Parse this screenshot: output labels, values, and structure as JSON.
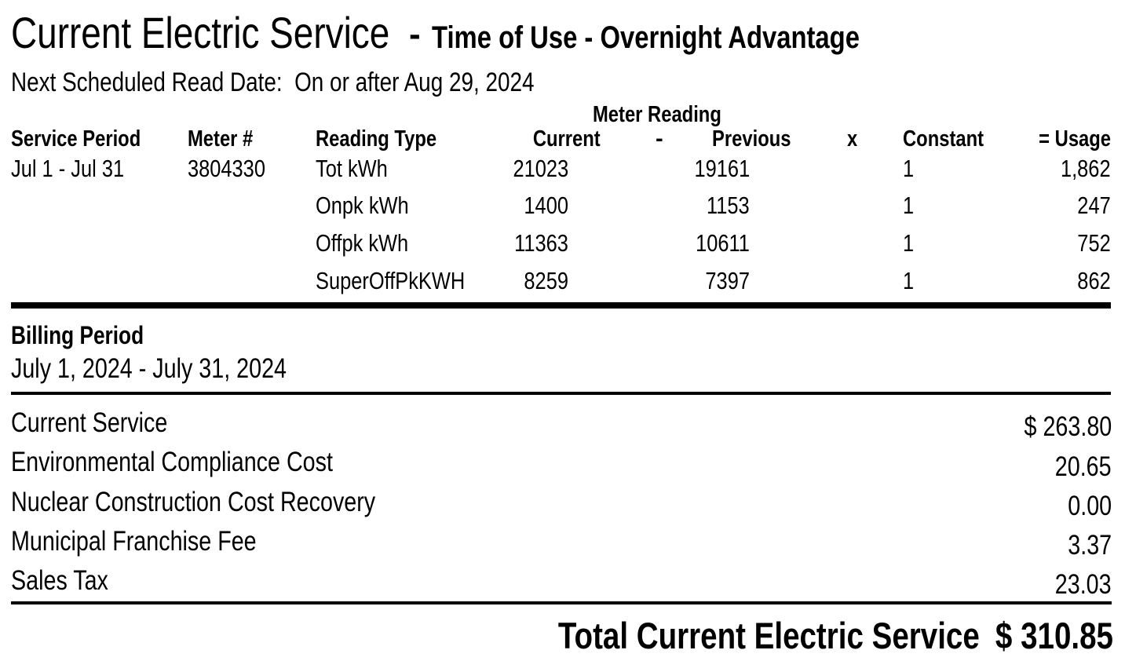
{
  "header": {
    "title": "Current Electric Service",
    "separator": "-",
    "rate_plan": "Time of Use - Overnight Advantage",
    "next_read_label": "Next Scheduled Read Date:",
    "next_read_value": "On or after Aug 29, 2024"
  },
  "meter_table": {
    "group_header": "Meter Reading",
    "columns": {
      "service_period": "Service Period",
      "meter_number": "Meter #",
      "reading_type": "Reading Type",
      "current": "Current",
      "minus": "-",
      "previous": "Previous",
      "times": "x",
      "constant": "Constant",
      "usage": "= Usage"
    },
    "service_period": "Jul 1 - Jul 31",
    "meter_number": "3804330",
    "rows": [
      {
        "reading_type": "Tot kWh",
        "current": "21023",
        "previous": "19161",
        "constant": "1",
        "usage": "1,862"
      },
      {
        "reading_type": "Onpk kWh",
        "current": "1400",
        "previous": "1153",
        "constant": "1",
        "usage": "247"
      },
      {
        "reading_type": "Offpk kWh",
        "current": "11363",
        "previous": "10611",
        "constant": "1",
        "usage": "752"
      },
      {
        "reading_type": "SuperOffPkKWH",
        "current": "8259",
        "previous": "7397",
        "constant": "1",
        "usage": "862"
      }
    ]
  },
  "billing_period": {
    "label": "Billing Period",
    "value": "July 1, 2024 - July 31, 2024"
  },
  "charges": [
    {
      "label": "Current Service",
      "amount": "$ 263.80"
    },
    {
      "label": "Environmental Compliance Cost",
      "amount": "20.65"
    },
    {
      "label": "Nuclear Construction Cost Recovery",
      "amount": "0.00"
    },
    {
      "label": "Municipal Franchise Fee",
      "amount": "3.37"
    },
    {
      "label": "Sales Tax",
      "amount": "23.03"
    }
  ],
  "total": {
    "label": "Total Current Electric Service",
    "amount": "$ 310.85"
  }
}
